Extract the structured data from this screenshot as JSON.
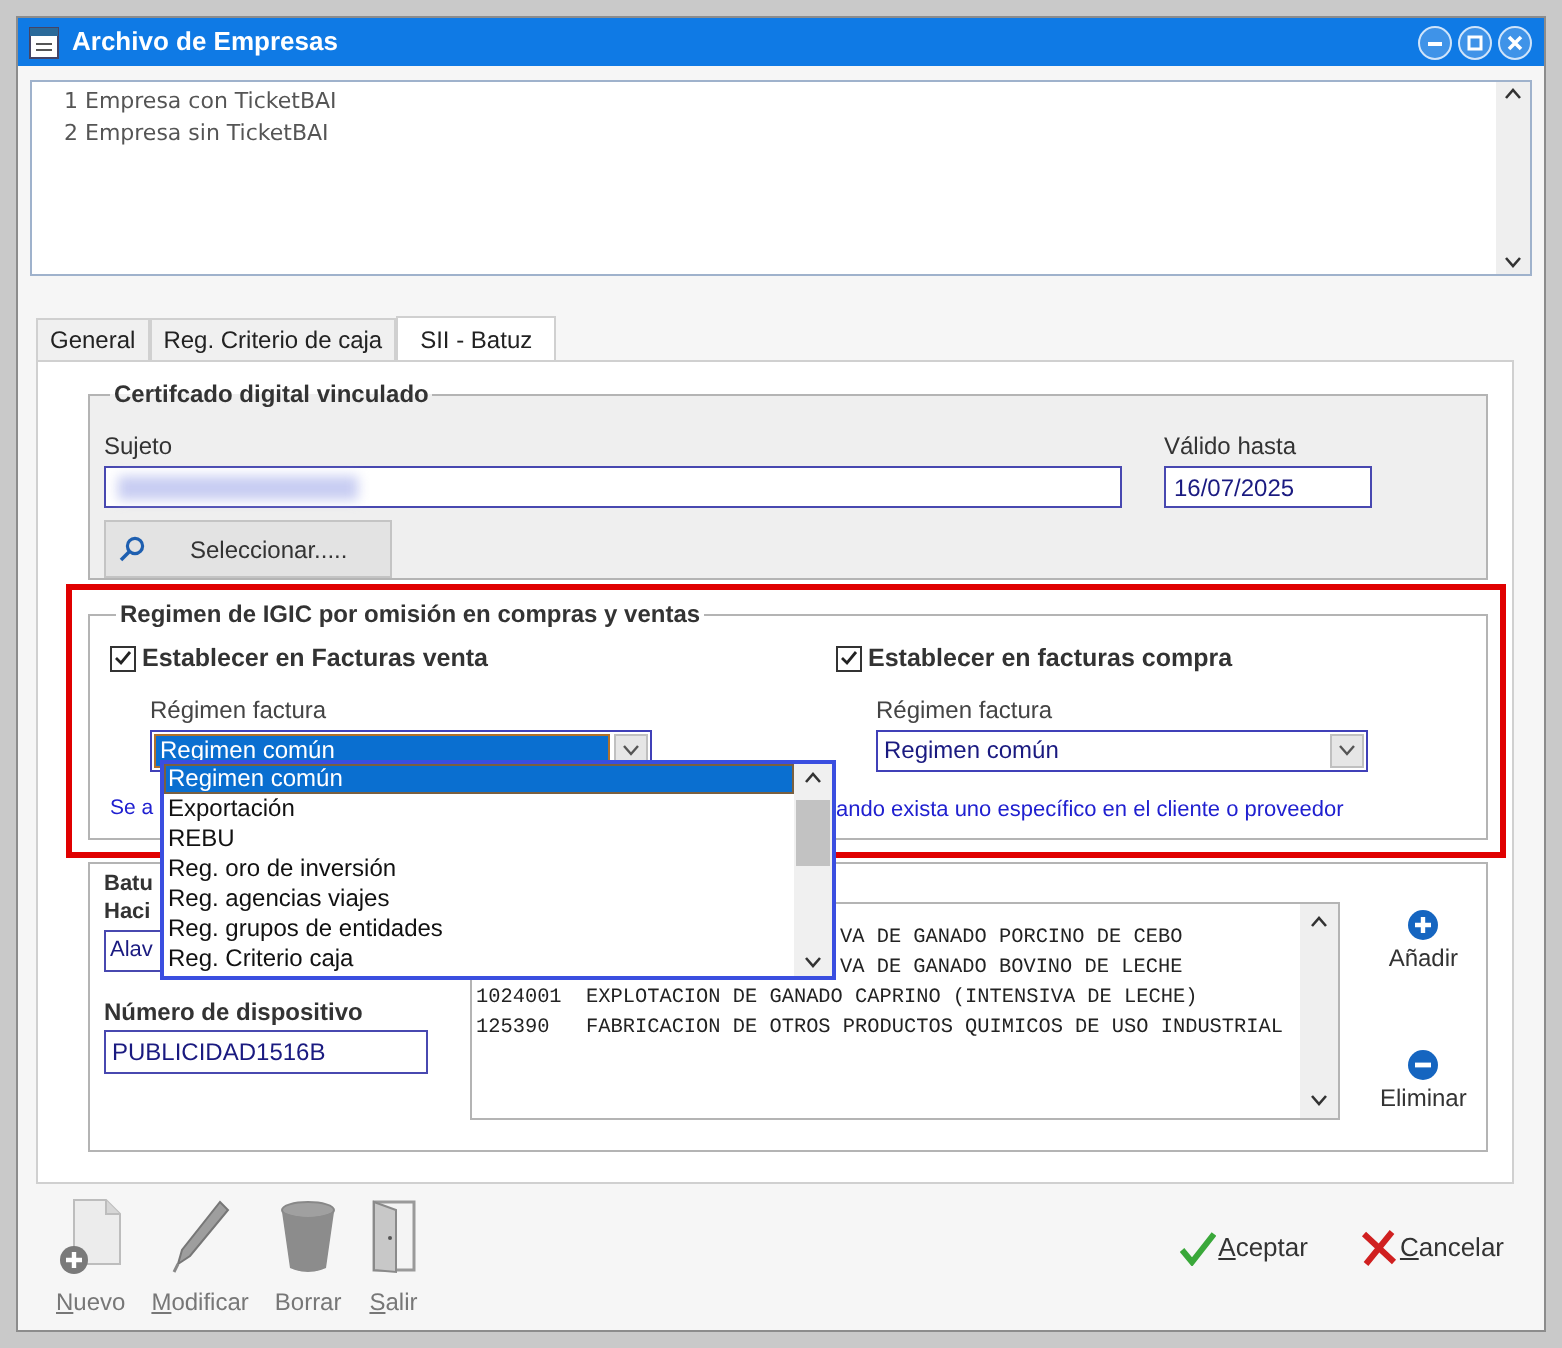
{
  "window": {
    "title": "Archivo de Empresas"
  },
  "companies": [
    "1 Empresa con TicketBAI",
    "2 Empresa sin TicketBAI"
  ],
  "tabs": [
    {
      "label": "General",
      "selected": false
    },
    {
      "label": "Reg. Criterio de caja",
      "selected": false
    },
    {
      "label": "SII - Batuz",
      "selected": true
    }
  ],
  "certificate": {
    "title": "Certifcado digital vinculado",
    "subject_label": "Sujeto",
    "valid_label": "Válido hasta",
    "valid_value": "16/07/2025",
    "select_button": "Seleccionar....."
  },
  "regime": {
    "title": "Regimen de IGIC por omisión en compras y ventas",
    "highlighted": true,
    "sales": {
      "label": "Establecer en Facturas venta",
      "checked": true,
      "field_label": "Régimen factura",
      "value": "Regimen común",
      "focused": true,
      "expanded": true,
      "options": [
        {
          "label": "Regimen común",
          "selected": true
        },
        {
          "label": "Exportación",
          "selected": false
        },
        {
          "label": "REBU",
          "selected": false
        },
        {
          "label": "Reg. oro de inversión",
          "selected": false
        },
        {
          "label": "Reg. agencias viajes",
          "selected": false
        },
        {
          "label": "Reg. grupos de entidades",
          "selected": false
        },
        {
          "label": "Reg. Criterio caja",
          "selected": false
        }
      ]
    },
    "purchases": {
      "label": "Establecer en facturas compra",
      "checked": true,
      "field_label": "Régimen factura",
      "value": "Regimen común",
      "focused": false
    },
    "note_start": "Se a",
    "note_end": "ando exista uno específico en el cliente o proveedor"
  },
  "batuz": {
    "label_1": "Batu",
    "label_2": "Haci",
    "field_value": "Alav",
    "device_label": "Número de dispositivo",
    "device_value": "PUBLICIDAD1516B",
    "activities": [
      {
        "text": "VA DE GANADO PORCINO DE CEBO",
        "kind": "covered"
      },
      {
        "text": "VA DE GANADO BOVINO DE LECHE",
        "kind": "covered"
      },
      {
        "text": "1024001  EXPLOTACION DE GANADO CAPRINO (INTENSIVA DE LECHE)",
        "kind": "full"
      },
      {
        "text": "125390   FABRICACION DE OTROS PRODUCTOS QUIMICOS DE USO INDUSTRIAL",
        "kind": "full"
      }
    ],
    "add_button": "Añadir",
    "remove_button": "Eliminar"
  },
  "toolbar": [
    {
      "label": "Nuevo",
      "kind": "new",
      "mnemonic": true
    },
    {
      "label": "Modificar",
      "kind": "edit",
      "mnemonic": true
    },
    {
      "label": "Borrar",
      "kind": "delete",
      "mnemonic": false
    },
    {
      "label": "Salir",
      "kind": "exit",
      "mnemonic": true
    }
  ],
  "buttons": [
    {
      "label": "Aceptar",
      "kind": "accept",
      "mnemonic": true
    },
    {
      "label": "Cancelar",
      "kind": "cancel",
      "mnemonic": true
    }
  ]
}
